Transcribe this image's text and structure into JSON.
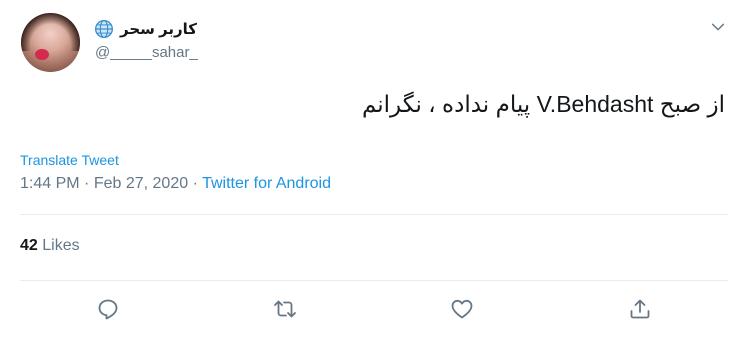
{
  "author": {
    "display_name": "کاربر سحر",
    "handle": "@_____sahar_"
  },
  "tweet": {
    "text": "از صبح V.Behdasht پیام نداده ، نگرانم",
    "translate_label": "Translate Tweet",
    "time": "1:44 PM",
    "separator": "·",
    "date": "Feb 27, 2020",
    "source": "Twitter for Android"
  },
  "stats": {
    "likes_count": "42",
    "likes_label": "Likes"
  },
  "icons": {
    "globe": "globe-icon",
    "chevron": "chevron-down-icon",
    "reply": "reply-icon",
    "retweet": "retweet-icon",
    "like": "heart-icon",
    "share": "share-icon"
  },
  "colors": {
    "link": "#1b95e0",
    "secondary_text": "#657786",
    "primary_text": "#14171a",
    "divider": "#e6ecf0"
  }
}
